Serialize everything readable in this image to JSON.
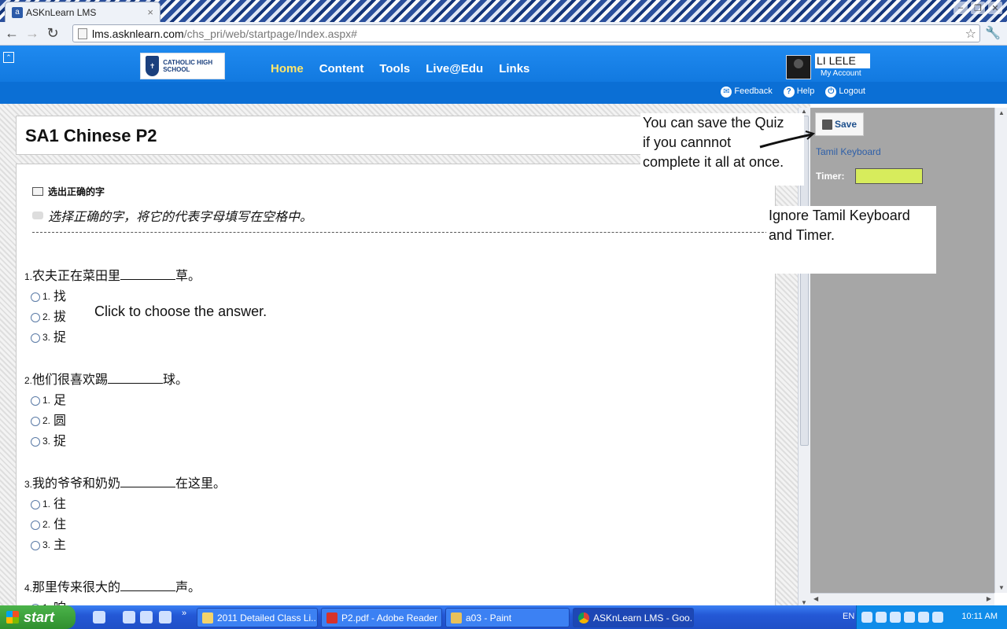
{
  "browser": {
    "tab_title": "ASKnLearn LMS",
    "url_host": "lms.asknlearn.com",
    "url_path": "/chs_pri/web/startpage/Index.aspx#"
  },
  "header": {
    "school_logo_text": "CATHOLIC HIGH SCHOOL",
    "nav": [
      "Home",
      "Content",
      "Tools",
      "Live@Edu",
      "Links"
    ],
    "user_name": "LI LELE",
    "my_account": "My Account",
    "links": {
      "feedback": "Feedback",
      "help": "Help",
      "logout": "Logout"
    }
  },
  "quiz": {
    "title": "SA1 Chinese P2",
    "section_title": "选出正确的字",
    "instruction": "选择正确的字，将它的代表字母填写在空格中。",
    "questions": [
      {
        "num": "1.",
        "before": "农夫正在菜田里",
        "after": "草。",
        "options": [
          "找",
          "拔",
          "捉"
        ]
      },
      {
        "num": "2.",
        "before": "他们很喜欢踢",
        "after": "球。",
        "options": [
          "足",
          "圆",
          "捉"
        ]
      },
      {
        "num": "3.",
        "before": "我的爷爷和奶奶",
        "after": "在这里。",
        "options": [
          "往",
          "住",
          "主"
        ]
      },
      {
        "num": "4.",
        "before": "那里传来很大的",
        "after": "声。",
        "options": [
          "响"
        ]
      }
    ],
    "option_numbers": [
      "1.",
      "2.",
      "3."
    ]
  },
  "side_panel": {
    "save_label": "Save",
    "tamil_keyboard": "Tamil Keyboard",
    "timer_label": "Timer:",
    "timer_color": "#d7ec5c"
  },
  "annotations": {
    "save_note": [
      "You can save the Quiz",
      "if you cannnot",
      "complete it all at once."
    ],
    "ignore_note": [
      "Ignore Tamil Keyboard",
      "and Timer."
    ],
    "click_note": "Click to choose the answer."
  },
  "taskbar": {
    "start": "start",
    "items": [
      "2011 Detailed Class Li...",
      "P2.pdf - Adobe Reader",
      "a03 - Paint",
      "ASKnLearn LMS - Goo..."
    ],
    "lang": "EN",
    "clock": "10:11 AM"
  },
  "colors": {
    "header_blue": "#0a6fd6",
    "active_nav": "#ffe66b",
    "panel_gray": "#a6a6a6"
  }
}
